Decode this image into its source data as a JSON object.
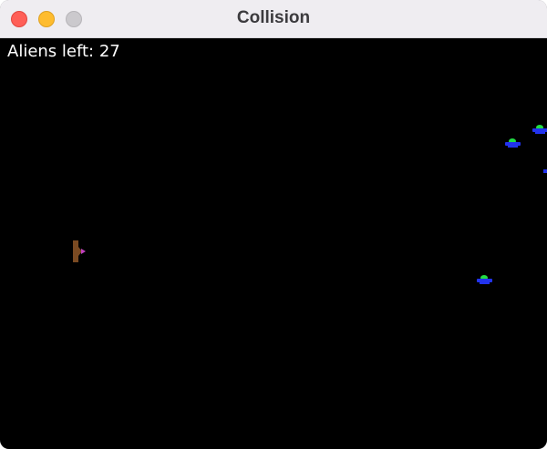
{
  "window": {
    "title": "Collision"
  },
  "hud": {
    "aliens_left_text": "Aliens left: 27"
  },
  "colors": {
    "background": "#000000",
    "hud_text": "#ffffff",
    "ship_body": "#7a4a22",
    "ship_nose": "#c040c0",
    "alien_dome": "#22dd44",
    "alien_body": "#2233ee"
  },
  "sprites": {
    "player": {
      "icon": "spaceship-icon"
    },
    "aliens": [
      {
        "icon": "alien-ufo-icon"
      },
      {
        "icon": "alien-ufo-icon"
      },
      {
        "icon": "alien-ufo-icon"
      },
      {
        "icon": "alien-ufo-icon"
      }
    ]
  }
}
